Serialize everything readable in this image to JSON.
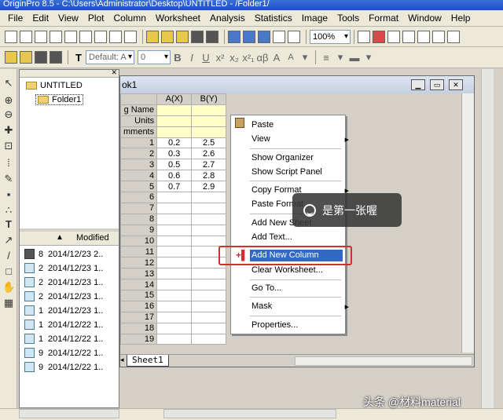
{
  "window": {
    "title": "OriginPro 8.5 - C:\\Users\\Administrator\\Desktop\\UNTITLED - /Folder1/"
  },
  "menu": [
    "File",
    "Edit",
    "View",
    "Plot",
    "Column",
    "Worksheet",
    "Analysis",
    "Statistics",
    "Image",
    "Tools",
    "Format",
    "Window",
    "Help"
  ],
  "toolbar": {
    "zoom": "100%",
    "font": "Default: A",
    "font_size": "0",
    "glyphs": [
      "B",
      "I",
      "U",
      "x²",
      "x₂",
      "x²₁",
      "αβ",
      "A",
      "A"
    ]
  },
  "explorer": {
    "root": "UNTITLED",
    "folder": "Folder1",
    "list_header": "Modified",
    "items": [
      {
        "icon": "workbook-icon",
        "name": "8",
        "modified": "2014/12/23 2.."
      },
      {
        "icon": "graph-icon",
        "name": "2",
        "modified": "2014/12/23 1.."
      },
      {
        "icon": "graph-icon",
        "name": "2",
        "modified": "2014/12/23 1.."
      },
      {
        "icon": "graph-icon",
        "name": "2",
        "modified": "2014/12/23 1.."
      },
      {
        "icon": "graph-icon",
        "name": "1",
        "modified": "2014/12/23 1.."
      },
      {
        "icon": "graph-icon",
        "name": "1",
        "modified": "2014/12/22 1.."
      },
      {
        "icon": "graph-icon",
        "name": "1",
        "modified": "2014/12/22 1.."
      },
      {
        "icon": "graph-icon",
        "name": "9",
        "modified": "2014/12/22 1.."
      },
      {
        "icon": "graph-icon",
        "name": "9",
        "modified": "2014/12/22 1.."
      }
    ]
  },
  "workbook": {
    "title": "ok1",
    "col_headers": [
      "A(X)",
      "B(Y)"
    ],
    "meta_rows": [
      "g Name",
      "Units",
      "mments"
    ],
    "rows": [
      [
        "1",
        "0.2",
        "2.5"
      ],
      [
        "2",
        "0.3",
        "2.6"
      ],
      [
        "3",
        "0.5",
        "2.7"
      ],
      [
        "4",
        "0.6",
        "2.8"
      ],
      [
        "5",
        "0.7",
        "2.9"
      ],
      [
        "6",
        "",
        ""
      ],
      [
        "7",
        "",
        ""
      ],
      [
        "8",
        "",
        ""
      ],
      [
        "9",
        "",
        ""
      ],
      [
        "10",
        "",
        ""
      ],
      [
        "11",
        "",
        ""
      ],
      [
        "12",
        "",
        ""
      ],
      [
        "13",
        "",
        ""
      ],
      [
        "14",
        "",
        ""
      ],
      [
        "15",
        "",
        ""
      ],
      [
        "16",
        "",
        ""
      ],
      [
        "17",
        "",
        ""
      ],
      [
        "18",
        "",
        ""
      ],
      [
        "19",
        "",
        ""
      ]
    ],
    "sheet_tab": "Sheet1"
  },
  "context_menu": {
    "paste": "Paste",
    "view": "View",
    "show_organizer": "Show Organizer",
    "show_script_panel": "Show Script Panel",
    "copy_format": "Copy Format",
    "paste_format": "Paste Format",
    "add_new_sheet": "Add New Sheet",
    "add_text": "Add Text...",
    "add_new_column": "Add New Column",
    "clear_worksheet": "Clear Worksheet...",
    "go_to": "Go To...",
    "mask": "Mask",
    "properties": "Properties..."
  },
  "overlay": {
    "text": "是第一张喔"
  },
  "watermark": "头条 @材料material"
}
